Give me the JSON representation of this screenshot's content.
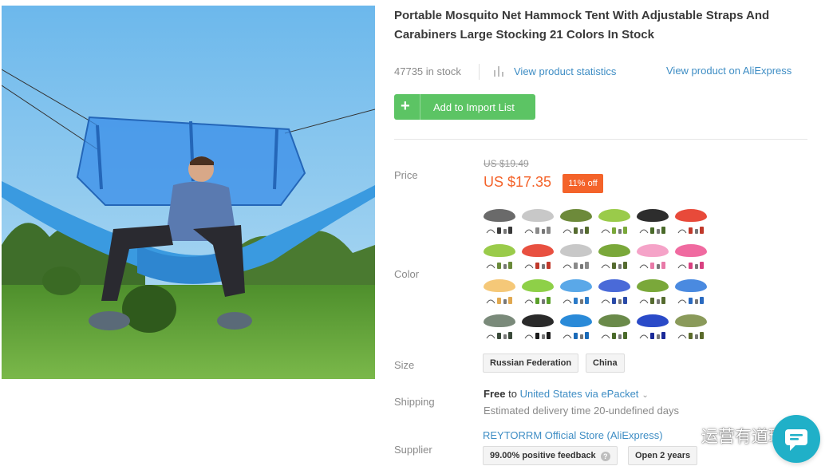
{
  "product": {
    "title": "Portable Mosquito Net Hammock Tent With Adjustable Straps And Carabiners Large Stocking 21 Colors In Stock",
    "stock": "47735 in stock",
    "view_statistics": "View product statistics",
    "view_on_aliexpress": "View product on AliExpress",
    "add_button": "Add to Import List"
  },
  "price": {
    "label": "Price",
    "original": "US $19.49",
    "current": "US $17.35",
    "discount": "11% off"
  },
  "color": {
    "label": "Color",
    "swatches": [
      {
        "net": "#6a6a6a",
        "base": "#3a3a3a",
        "icon": "hammock-swatch-black"
      },
      {
        "net": "#c8c8c8",
        "base": "#8a8a8a",
        "icon": "hammock-swatch-gray"
      },
      {
        "net": "#6d8a3a",
        "base": "#556b2f",
        "icon": "hammock-swatch-army-green"
      },
      {
        "net": "#9acb4a",
        "base": "#7aa83a",
        "icon": "hammock-swatch-light-green"
      },
      {
        "net": "#2d2d2d",
        "base": "#4a6a2a",
        "icon": "hammock-swatch-dark-green"
      },
      {
        "net": "#e84a3a",
        "base": "#c0392b",
        "icon": "hammock-swatch-red"
      },
      {
        "net": "#9acb4a",
        "base": "#6a8a3a",
        "icon": "hammock-swatch-lime"
      },
      {
        "net": "#e85040",
        "base": "#c0392b",
        "icon": "hammock-swatch-red-2"
      },
      {
        "net": "#c8c8c8",
        "base": "#8a8a8a",
        "icon": "hammock-swatch-silver"
      },
      {
        "net": "#7aa83a",
        "base": "#556b2f",
        "icon": "hammock-swatch-olive"
      },
      {
        "net": "#f5a3c8",
        "base": "#e87aa8",
        "icon": "hammock-swatch-pink"
      },
      {
        "net": "#f06aa0",
        "base": "#d84080",
        "icon": "hammock-swatch-rose"
      },
      {
        "net": "#f5c878",
        "base": "#e0a850",
        "icon": "hammock-swatch-yellow"
      },
      {
        "net": "#8ed048",
        "base": "#5aa02a",
        "icon": "hammock-swatch-green"
      },
      {
        "net": "#5aa8e8",
        "base": "#2a7ac8",
        "icon": "hammock-swatch-sky-blue"
      },
      {
        "net": "#4a6ad8",
        "base": "#2a4aa8",
        "icon": "hammock-swatch-royal-blue"
      },
      {
        "net": "#7aa83a",
        "base": "#556b2f",
        "icon": "hammock-swatch-khaki"
      },
      {
        "net": "#4a8ae0",
        "base": "#2a6ac0",
        "icon": "hammock-swatch-blue"
      },
      {
        "net": "#7a8a7a",
        "base": "#3a4a3a",
        "icon": "tarp-swatch-gray"
      },
      {
        "net": "#2a2a2a",
        "base": "#1a1a1a",
        "icon": "tarp-swatch-black"
      },
      {
        "net": "#2a8ad8",
        "base": "#1a6ab8",
        "icon": "tarp-swatch-blue"
      },
      {
        "net": "#6a8a4a",
        "base": "#4a6a2a",
        "icon": "tarp-swatch-green"
      },
      {
        "net": "#2a4ac8",
        "base": "#1a2a98",
        "icon": "hammock-swatch-navy"
      },
      {
        "net": "#8a9a5a",
        "base": "#5a6a2a",
        "icon": "hammock-swatch-camo"
      }
    ]
  },
  "size": {
    "label": "Size",
    "options": [
      "Russian Federation",
      "China"
    ]
  },
  "shipping": {
    "label": "Shipping",
    "free": "Free",
    "to": "to",
    "destination": "United States via ePacket",
    "estimate": "Estimated delivery time 20-undefined days"
  },
  "supplier": {
    "label": "Supplier",
    "name": "REYTORRM Official Store (AliExpress)",
    "feedback": "99.00% positive feedback",
    "open": "Open 2 years"
  },
  "watermark": {
    "text": "运营有道理"
  },
  "colors": {
    "accent_green": "#5cc464",
    "link_blue": "#3e8dc4",
    "price_orange": "#f4632a",
    "chat_teal": "#20b0c8"
  }
}
